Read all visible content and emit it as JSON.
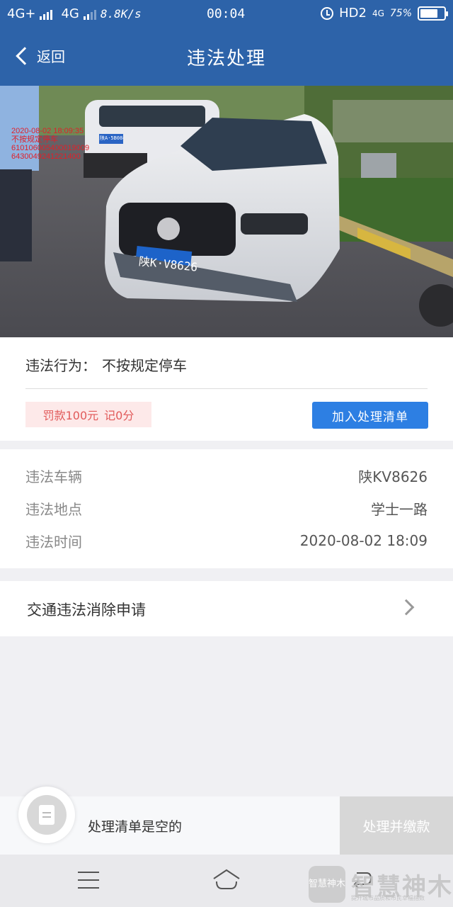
{
  "status_bar": {
    "net1": "4G+",
    "net2": "4G",
    "speed": "8.8K/s",
    "time": "00:04",
    "hd": "HD2",
    "net3": "4G",
    "battery_percent": 75,
    "battery_label": "75%"
  },
  "nav": {
    "back_label": "返回",
    "title": "违法处理"
  },
  "photo": {
    "stamp_lines": [
      "2020-08-02 18:09:35",
      "不按规定停车",
      "610106005400019009",
      "6430049241221400"
    ],
    "plate_text": "陕K·V8626",
    "plate_text_rear": "陕A·5B084"
  },
  "violation": {
    "behavior_label": "违法行为：",
    "behavior_value": "不按规定停车",
    "fine": "罚款100元",
    "points": "记0分",
    "add_button": "加入处理清单"
  },
  "details": {
    "rows": [
      {
        "key": "违法车辆",
        "value": "陕KV8626"
      },
      {
        "key": "违法地点",
        "value": "学士一路"
      },
      {
        "key": "违法时间",
        "value": "2020-08-02 18:09"
      }
    ]
  },
  "appeal": {
    "label": "交通违法消除申请"
  },
  "bottom_bar": {
    "empty_text": "处理清单是空的",
    "pay_button": "处理并缴款"
  },
  "watermark": {
    "logo_text": "智慧神木",
    "brand": "智慧神木",
    "tagline": "提升城市品质和市民幸福指数"
  },
  "colors": {
    "brand_blue": "#2d63a9",
    "button_blue": "#2d7fe3",
    "fine_bg": "#fde9e9",
    "fine_text": "#e15a5a"
  }
}
